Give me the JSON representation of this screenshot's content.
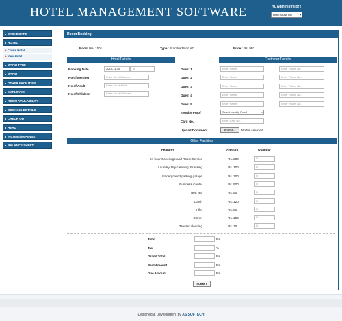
{
  "header": {
    "app_title": "HOTEL MANAGEMENT SOFTWARE",
    "greeting": "Hi, Administrator !",
    "hotel_selected": "Hotel Aruna Inn"
  },
  "sidebar": {
    "items": [
      {
        "label": "DASHBOARD"
      },
      {
        "label": "HOTEL"
      },
      {
        "label": "ROOM TYPE"
      },
      {
        "label": "ROOM"
      },
      {
        "label": "OTHER FACILITIES"
      },
      {
        "label": "EMPLOYEE"
      },
      {
        "label": "ROOM AVAILABILITY"
      },
      {
        "label": "BOOKING DETAILS"
      },
      {
        "label": "CHECK OUT"
      },
      {
        "label": "HEAD"
      },
      {
        "label": "INCOME/EXPENSE"
      },
      {
        "label": "BALANCE SHEET"
      }
    ],
    "hotel_sub": [
      "Create Hotel",
      "View Hotel"
    ]
  },
  "booking": {
    "panel_title": "Room Booking",
    "room_no_label": "Room No.",
    "room_no": ": 101",
    "type_label": "Type",
    "type_value": ": Standrad Non AC",
    "price_label": "Price",
    "price_value": ": Rs. 950"
  },
  "hotel_details": {
    "title": "Hotel Details",
    "booking_date_label": "Booking Date",
    "booking_date_value": "2015-11-30",
    "to_placeholder": "To",
    "members_label": "No of Member",
    "members_placeholder": "Enter No of Member",
    "adult_label": "No of Adult",
    "adult_placeholder": "Enter No of Adult",
    "children_label": "No of Children",
    "children_placeholder": "Enter No of Children"
  },
  "customer_details": {
    "title": "Customer Details",
    "guests": [
      {
        "label": "Guest 1"
      },
      {
        "label": "Guest 2"
      },
      {
        "label": "Guest 3"
      },
      {
        "label": "Guest 4"
      },
      {
        "label": "Guest 5"
      }
    ],
    "name_placeholder": "Enter Name",
    "phone_placeholder": "Enter Phone No.",
    "identity_label": "Identity Proof",
    "identity_selected": "Select Identity Proof",
    "card_label": "Card No.",
    "card_placeholder": "Enter Card No.",
    "upload_label": "Upload Document",
    "browse_label": "Browse...",
    "no_file_text": "No file selected."
  },
  "facilities": {
    "title": "Other Facilities",
    "col_features": "Features",
    "col_amount": "Amount",
    "col_quantity": "Quantity",
    "rows": [
      {
        "feature": "24-hour Concierge and Room Service",
        "amount": "Rs. 200",
        "qty": "0"
      },
      {
        "feature": "Laundry, Dry cleaning, Pressing",
        "amount": "Rs. 100",
        "qty": "0"
      },
      {
        "feature": "Underground parking garage",
        "amount": "Rs. 200",
        "qty": "0"
      },
      {
        "feature": "Business Center",
        "amount": "Rs. 500",
        "qty": "0"
      },
      {
        "feature": "Bed Tea",
        "amount": "Rs. 50",
        "qty": "0"
      },
      {
        "feature": "Lunch",
        "amount": "Rs. 120",
        "qty": "0"
      },
      {
        "feature": "Tiffin",
        "amount": "Rs. 60",
        "qty": "0"
      },
      {
        "feature": "Dinner",
        "amount": "Rs. 150",
        "qty": "0"
      },
      {
        "feature": "Trouser cleaning",
        "amount": "Rs. 30",
        "qty": "0"
      }
    ]
  },
  "totals": {
    "rows": [
      {
        "label": "Total",
        "unit": "Rs"
      },
      {
        "label": "Tax",
        "unit": "%"
      },
      {
        "label": "Grand Total",
        "unit": "Rs"
      },
      {
        "label": "Paid Amount",
        "unit": "Rs"
      },
      {
        "label": "Due Amount",
        "unit": "Rs"
      }
    ],
    "submit_label": "SUBMIT"
  },
  "footer": {
    "prefix": "Designed & Development by",
    "company": "AS SOFTECH"
  },
  "colors": {
    "primary": "#1e5f8e",
    "accent_dot": "#cc3333"
  }
}
